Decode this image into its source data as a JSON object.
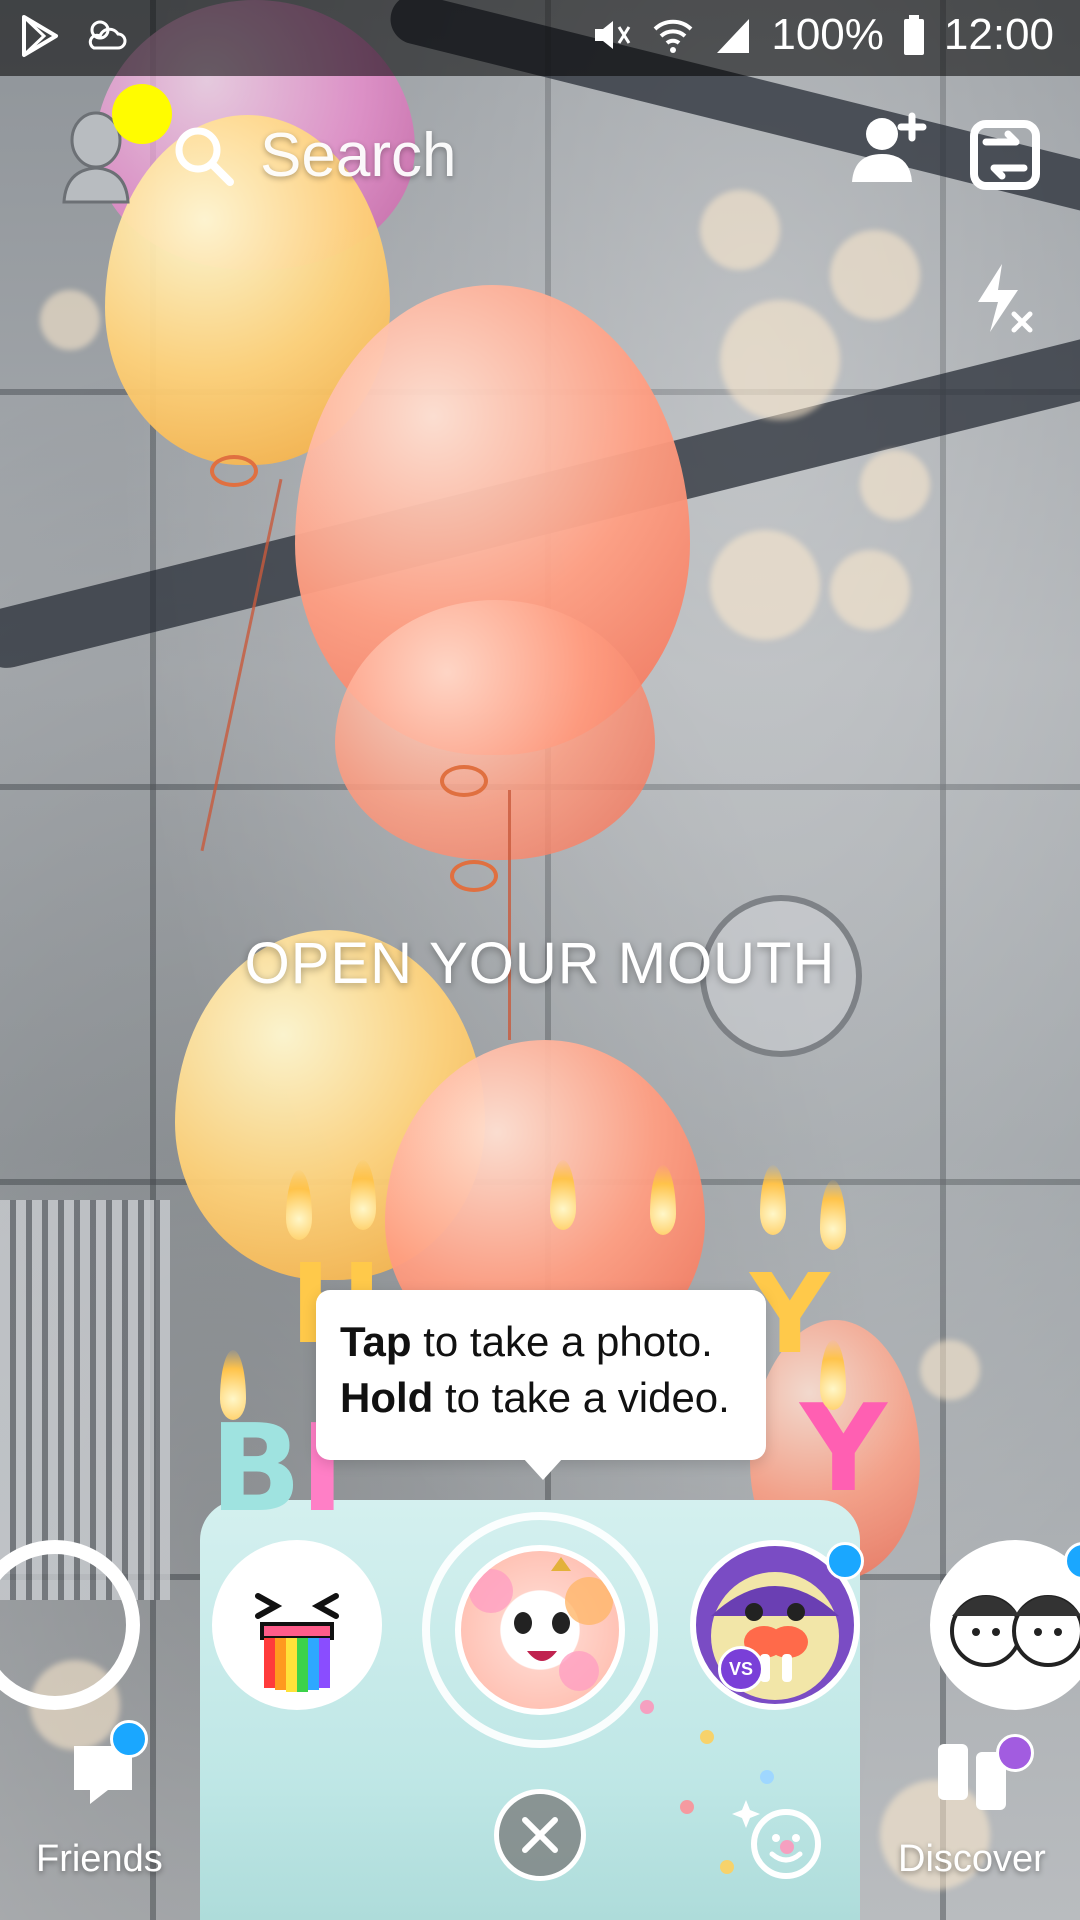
{
  "status_bar": {
    "battery": "100%",
    "time": "12:00",
    "icons": [
      "play-store-icon",
      "weather-icon",
      "mute-icon",
      "wifi-icon",
      "signal-icon",
      "battery-icon"
    ]
  },
  "header": {
    "search_label": "Search",
    "avatar_notification_color": "#FFFC00"
  },
  "prompt": {
    "text": "OPEN YOUR MOUTH"
  },
  "tooltip": {
    "line1_bold": "Tap",
    "line1_rest": " to take a photo.",
    "line2_bold": "Hold",
    "line2_rest": " to take a video."
  },
  "lenses": [
    {
      "name": "empty-lens",
      "selected": false
    },
    {
      "name": "rainbow-vomit-lens",
      "selected": false
    },
    {
      "name": "birthday-face-lens",
      "selected": true
    },
    {
      "name": "walrus-vs-lens",
      "badge": "VS",
      "selected": false
    },
    {
      "name": "twins-lens",
      "selected": false
    }
  ],
  "bottom_nav": {
    "friends_label": "Friends",
    "discover_label": "Discover"
  },
  "colors": {
    "notification_blue": "#1AA7FF",
    "discover_purple": "#A25CE0",
    "snap_yellow": "#FFFC00"
  }
}
